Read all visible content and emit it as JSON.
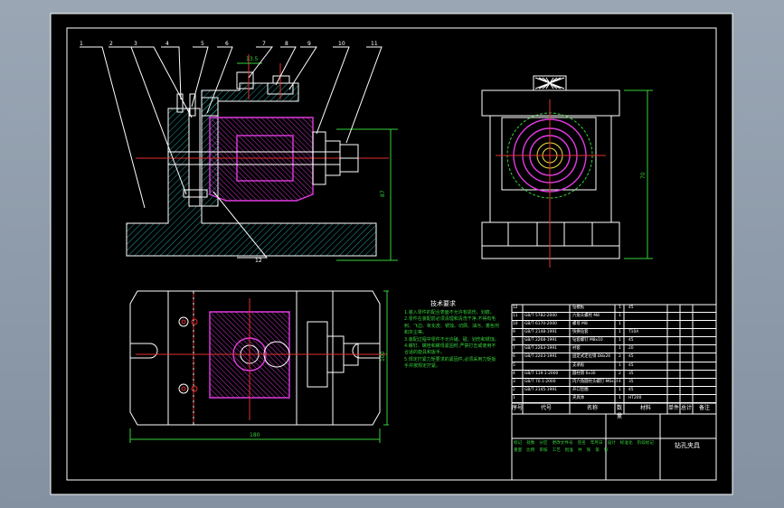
{
  "drawing": {
    "part_labels": [
      "1",
      "2",
      "3",
      "4",
      "5",
      "6",
      "7",
      "8",
      "9",
      "10",
      "11",
      "12"
    ],
    "title_block": {
      "drawing_name": "钻孔夹具",
      "header": [
        "序号",
        "代号",
        "名称",
        "数量",
        "材料",
        "单件",
        "总计",
        "备注"
      ],
      "sign_labels": [
        "标记",
        "处数",
        "分区",
        "更改文件号",
        "签名",
        "年月日",
        "设计",
        "标准化",
        "阶段标记",
        "重量",
        "比例",
        "审核",
        "工艺",
        "批准",
        "共",
        "张",
        "第",
        "张"
      ],
      "weight_labels": [
        "单件",
        "总计"
      ],
      "parts_list": [
        {
          "no": "12",
          "code": "",
          "name": "钻模板",
          "qty": "1",
          "mat": "45"
        },
        {
          "no": "11",
          "code": "GB/T 5782-2000",
          "name": "六角头螺栓 M8",
          "qty": "1",
          "mat": ""
        },
        {
          "no": "10",
          "code": "GB/T 6170-2000",
          "name": "螺母 M8",
          "qty": "1",
          "mat": ""
        },
        {
          "no": "9",
          "code": "GB/T 2148-1991",
          "name": "快换钻套",
          "qty": "1",
          "mat": "T10A"
        },
        {
          "no": "8",
          "code": "GB/T 2268-1991",
          "name": "钻套螺钉 M8x10",
          "qty": "1",
          "mat": "45"
        },
        {
          "no": "7",
          "code": "GB/T 2263-1991",
          "name": "衬套",
          "qty": "1",
          "mat": "20"
        },
        {
          "no": "6",
          "code": "GB/T 2203-1991",
          "name": "固定式定位销 D8x26",
          "qty": "2",
          "mat": "45"
        },
        {
          "no": "5",
          "code": "",
          "name": "支承板",
          "qty": "1",
          "mat": "45"
        },
        {
          "no": "4",
          "code": "GB/T 119.1-2000",
          "name": "圆柱销 6x30",
          "qty": "2",
          "mat": "35"
        },
        {
          "no": "3",
          "code": "GB/T 70.1-2000",
          "name": "内六角圆柱头螺钉 M6x16",
          "qty": "4",
          "mat": "35"
        },
        {
          "no": "2",
          "code": "GB/T 2145-1991",
          "name": "开口垫圈",
          "qty": "1",
          "mat": "45"
        },
        {
          "no": "1",
          "code": "",
          "name": "夹具体",
          "qty": "1",
          "mat": "HT200"
        }
      ]
    },
    "tech_req": {
      "title": "技术要求",
      "lines": [
        "1.装入零件的配合表面不允许有损伤、划痕。",
        "2.零件在装配前必须清理和清洗干净,不得有毛刺、飞边、氧化皮、锈蚀、切屑、油污、着色剂和灰尘等。",
        "3.装配过程中零件不允许磕、碰、划伤和锈蚀。",
        "4.螺钉、螺栓和螺母紧固时,严禁打击或使用不合适的旋具和扳手。",
        "5.规定拧紧力矩要求的紧固件,必须采用力矩扳手并按规定拧紧。"
      ]
    },
    "dims": {
      "d1": "87",
      "d2": "70",
      "d3": "100",
      "d4": "180",
      "d5": "13.5"
    }
  }
}
